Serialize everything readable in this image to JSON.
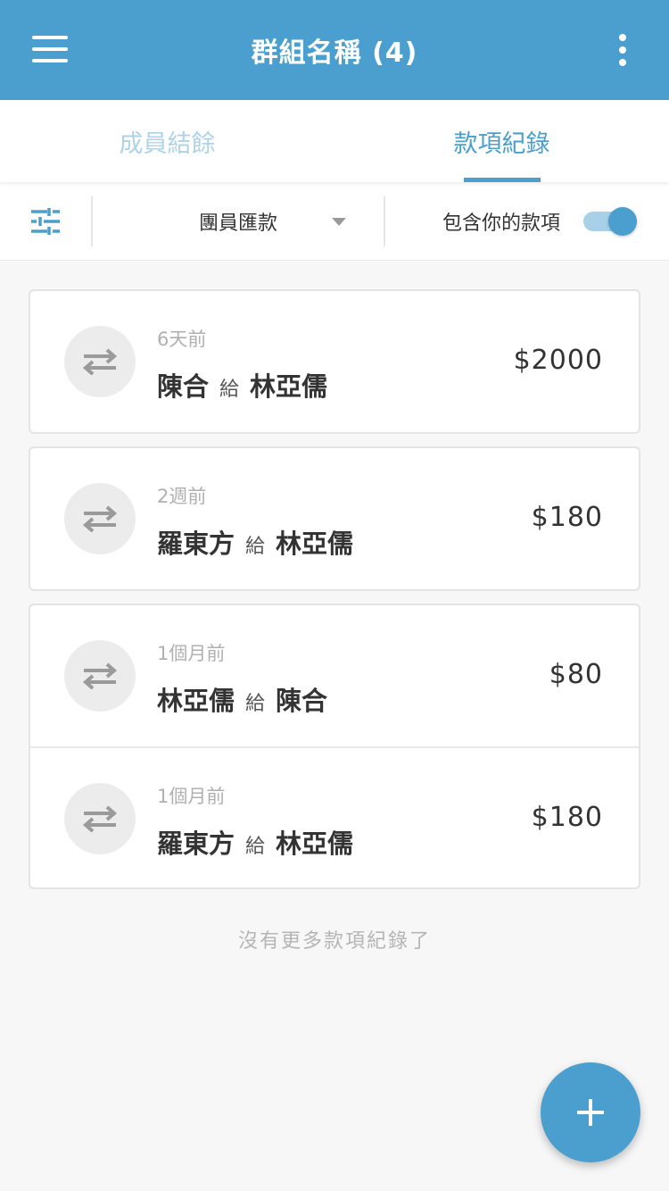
{
  "appbar": {
    "title": "群組名稱 (4)",
    "menu_icon": "hamburger-icon",
    "more_icon": "more-vertical-icon"
  },
  "tabs": [
    {
      "label": "成員結餘",
      "active": false
    },
    {
      "label": "款項紀錄",
      "active": true
    }
  ],
  "filter": {
    "filter_icon": "sliders-icon",
    "dropdown_value": "團員匯款",
    "include_label": "包含你的款項",
    "include_enabled": true
  },
  "groups": [
    {
      "items": [
        {
          "time": "6天前",
          "from": "陳合",
          "connector": "給",
          "to": "林亞儒",
          "amount": "$2000"
        }
      ]
    },
    {
      "items": [
        {
          "time": "2週前",
          "from": "羅東方",
          "connector": "給",
          "to": "林亞儒",
          "amount": "$180"
        }
      ]
    },
    {
      "items": [
        {
          "time": "1個月前",
          "from": "林亞儒",
          "connector": "給",
          "to": "陳合",
          "amount": "$80"
        },
        {
          "time": "1個月前",
          "from": "羅東方",
          "connector": "給",
          "to": "林亞儒",
          "amount": "$180"
        }
      ]
    }
  ],
  "end_note": "沒有更多款項紀錄了",
  "fab_icon": "plus-icon",
  "colors": {
    "primary": "#4a9fcf",
    "tab_inactive": "#aed3e8",
    "background": "#f7f7f7"
  }
}
